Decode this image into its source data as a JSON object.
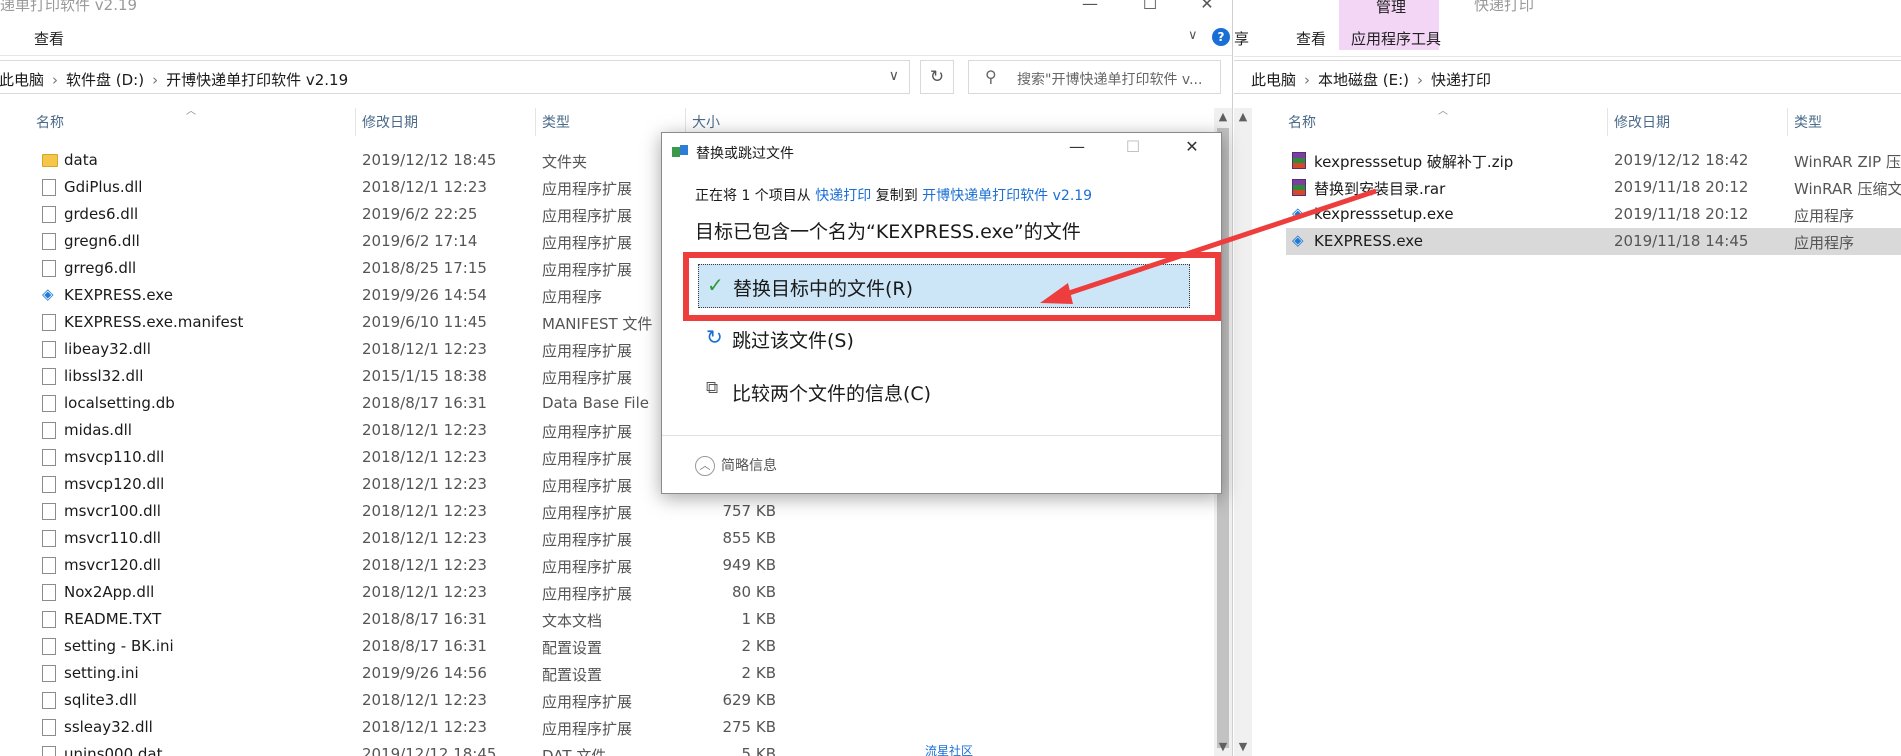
{
  "left": {
    "title_fragment": "递单打印软件 v2.19",
    "ribbon_tab": "查看",
    "breadcrumb": [
      "此电脑",
      "软件盘 (D:)",
      "开博快递单打印软件 v2.19"
    ],
    "search_placeholder": "搜索\"开博快递单打印软件 v...",
    "columns": {
      "name": "名称",
      "date": "修改日期",
      "type": "类型",
      "size": "大小"
    },
    "files": [
      {
        "name": "data",
        "date": "2019/12/12 18:45",
        "type": "文件夹",
        "size": "",
        "icon": "folder-icon"
      },
      {
        "name": "GdiPlus.dll",
        "date": "2018/12/1 12:23",
        "type": "应用程序扩展",
        "size": "",
        "icon": "file-icon"
      },
      {
        "name": "grdes6.dll",
        "date": "2019/6/2 22:25",
        "type": "应用程序扩展",
        "size": "",
        "icon": "file-icon"
      },
      {
        "name": "gregn6.dll",
        "date": "2019/6/2 17:14",
        "type": "应用程序扩展",
        "size": "",
        "icon": "file-icon"
      },
      {
        "name": "grreg6.dll",
        "date": "2018/8/25 17:15",
        "type": "应用程序扩展",
        "size": "",
        "icon": "file-icon"
      },
      {
        "name": "KEXPRESS.exe",
        "date": "2019/9/26 14:54",
        "type": "应用程序",
        "size": "",
        "icon": "app-icon"
      },
      {
        "name": "KEXPRESS.exe.manifest",
        "date": "2019/6/10 11:45",
        "type": "MANIFEST 文件",
        "size": "",
        "icon": "file-icon"
      },
      {
        "name": "libeay32.dll",
        "date": "2018/12/1 12:23",
        "type": "应用程序扩展",
        "size": "",
        "icon": "file-icon"
      },
      {
        "name": "libssl32.dll",
        "date": "2015/1/15 18:38",
        "type": "应用程序扩展",
        "size": "",
        "icon": "file-icon"
      },
      {
        "name": "localsetting.db",
        "date": "2018/8/17 16:31",
        "type": "Data Base File",
        "size": "",
        "icon": "file-icon"
      },
      {
        "name": "midas.dll",
        "date": "2018/12/1 12:23",
        "type": "应用程序扩展",
        "size": "",
        "icon": "file-icon"
      },
      {
        "name": "msvcp110.dll",
        "date": "2018/12/1 12:23",
        "type": "应用程序扩展",
        "size": "",
        "icon": "file-icon"
      },
      {
        "name": "msvcp120.dll",
        "date": "2018/12/1 12:23",
        "type": "应用程序扩展",
        "size": "",
        "icon": "file-icon"
      },
      {
        "name": "msvcr100.dll",
        "date": "2018/12/1 12:23",
        "type": "应用程序扩展",
        "size": "757 KB",
        "icon": "file-icon"
      },
      {
        "name": "msvcr110.dll",
        "date": "2018/12/1 12:23",
        "type": "应用程序扩展",
        "size": "855 KB",
        "icon": "file-icon"
      },
      {
        "name": "msvcr120.dll",
        "date": "2018/12/1 12:23",
        "type": "应用程序扩展",
        "size": "949 KB",
        "icon": "file-icon"
      },
      {
        "name": "Nox2App.dll",
        "date": "2018/12/1 12:23",
        "type": "应用程序扩展",
        "size": "80 KB",
        "icon": "file-icon"
      },
      {
        "name": "README.TXT",
        "date": "2018/8/17 16:31",
        "type": "文本文档",
        "size": "1 KB",
        "icon": "file-icon"
      },
      {
        "name": "setting - BK.ini",
        "date": "2018/8/17 16:31",
        "type": "配置设置",
        "size": "2 KB",
        "icon": "file-icon"
      },
      {
        "name": "setting.ini",
        "date": "2019/9/26 14:56",
        "type": "配置设置",
        "size": "2 KB",
        "icon": "file-icon"
      },
      {
        "name": "sqlite3.dll",
        "date": "2018/12/1 12:23",
        "type": "应用程序扩展",
        "size": "629 KB",
        "icon": "file-icon"
      },
      {
        "name": "ssleay32.dll",
        "date": "2018/12/1 12:23",
        "type": "应用程序扩展",
        "size": "275 KB",
        "icon": "file-icon"
      },
      {
        "name": "unins000.dat",
        "date": "2019/12/12 18:45",
        "type": "DAT 文件",
        "size": "5 KB",
        "icon": "file-icon"
      }
    ],
    "bottom_link": "流星社区"
  },
  "right": {
    "ribbon": {
      "share_fragment": "享",
      "view": "查看",
      "manage": "管理",
      "app_tools": "应用程序工具",
      "title": "快递打印"
    },
    "breadcrumb": [
      "此电脑",
      "本地磁盘 (E:)",
      "快递打印"
    ],
    "columns": {
      "name": "名称",
      "date": "修改日期",
      "type": "类型"
    },
    "files": [
      {
        "name": "kexpresssetup 破解补丁.zip",
        "date": "2019/12/12 18:42",
        "type": "WinRAR ZIP 压",
        "icon": "archive-icon",
        "selected": false
      },
      {
        "name": "替换到安装目录.rar",
        "date": "2019/11/18 20:12",
        "type": "WinRAR 压缩文",
        "icon": "archive-icon",
        "selected": false
      },
      {
        "name": "kexpresssetup.exe",
        "date": "2019/11/18 20:12",
        "type": "应用程序",
        "icon": "setup-icon",
        "selected": false
      },
      {
        "name": "KEXPRESS.exe",
        "date": "2019/11/18 14:45",
        "type": "应用程序",
        "icon": "app-icon",
        "selected": true
      }
    ]
  },
  "dialog": {
    "title": "替换或跳过文件",
    "line_prefix": "正在将 1 个项目从",
    "source": "快递打印",
    "line_mid": "复制到",
    "dest": "开博快递单打印软件 v2.19",
    "heading": "目标已包含一个名为“KEXPRESS.exe”的文件",
    "options": [
      {
        "label": "替换目标中的文件(R)",
        "icon": "check-icon",
        "active": true
      },
      {
        "label": "跳过该文件(S)",
        "icon": "skip-icon",
        "active": false
      },
      {
        "label": "比较两个文件的信息(C)",
        "icon": "compare-icon",
        "active": false
      }
    ],
    "fewer_details": "简略信息"
  },
  "colors": {
    "highlight": "#ee3d3d",
    "selection": "#d9d9d9",
    "link": "#1a6fd6",
    "manage_tab": "#f3d6f5"
  }
}
